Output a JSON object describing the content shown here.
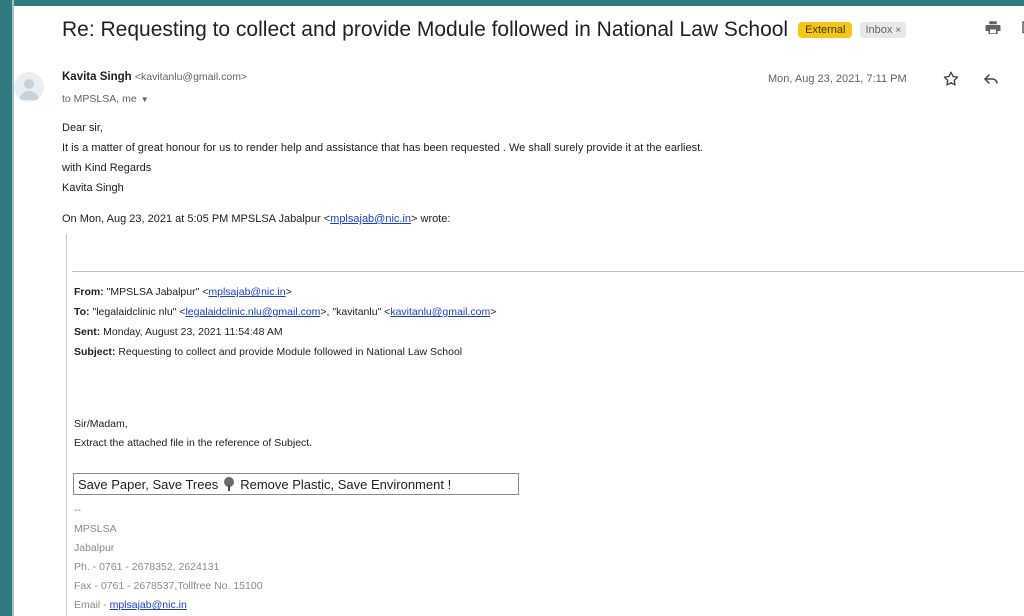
{
  "email": {
    "subject": "Re: Requesting to collect and provide Module followed in National Law School",
    "labels": {
      "external": "External",
      "inbox": "Inbox",
      "inbox_remove": "×"
    },
    "sender": {
      "name": "Kavita Singh",
      "email": "<kavitanlu@gmail.com>"
    },
    "to": "to MPSLSA, me",
    "date": "Mon, Aug 23, 2021, 7:11 PM",
    "body_lines": [
      "Dear sir,",
      "It is a matter of great honour for us to render  help and assistance that has been requested . We shall surely provide it at the earliest.",
      "with Kind Regards",
      "Kavita Singh"
    ],
    "wrote": {
      "prefix": "On Mon, Aug 23, 2021 at 5:05 PM MPSLSA Jabalpur <",
      "link": "mplsajab@nic.in",
      "suffix": "> wrote:"
    }
  },
  "quoted": {
    "from": {
      "label": "From:",
      "name": " \"MPSLSA Jabalpur\" <",
      "link": "mplsajab@nic.in",
      "end": ">"
    },
    "to": {
      "label": "To:",
      "p1": " \"legalaidclinic nlu\" <",
      "link1": "legalaidclinic.nlu@gmail.com",
      "p2": ">, \"kavitanlu\" <",
      "link2": "kavitanlu@gmail.com",
      "end": ">"
    },
    "sent": {
      "label": "Sent:",
      "value": " Monday, August 23, 2021 11:54:48 AM"
    },
    "subject": {
      "label": "Subject:",
      "value": " Requesting to collect and provide Module followed in National Law School"
    },
    "salutation": "Sir/Madam,",
    "instruction": "Extract the attached file in the reference of Subject.",
    "slogan_left": "Save Paper, Save Trees",
    "slogan_right": "Remove Plastic, Save Environment !",
    "signature": {
      "dash": "--",
      "org": "MPSLSA",
      "city": "Jabalpur",
      "phone": "Ph. - 0761 - 2678352, 2624131",
      "fax": "Fax - 0761 - 2678537,Tollfree No. 15100",
      "email_label": "Email - ",
      "email_link": "mplsajab@nic.in"
    }
  },
  "colors": {
    "frame": "#2e7c7f",
    "external_label": "#f5c518",
    "link": "#1a3fd0"
  }
}
